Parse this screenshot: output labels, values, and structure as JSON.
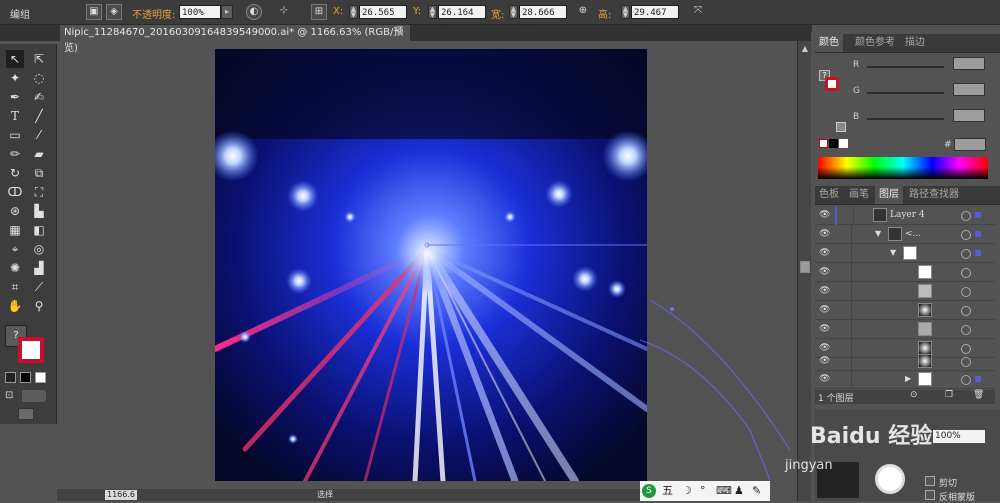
{
  "control_bar": {
    "group_label": "编组",
    "opacity_label": "不透明度:",
    "opacity_value": "100%",
    "x_label": "X:",
    "x_value": "26.565 mm",
    "y_label": "Y:",
    "y_value": "26.164 mm",
    "w_label": "宽:",
    "w_value": "28.666 mm",
    "h_label": "高:",
    "h_value": "29.467 mm"
  },
  "document": {
    "tab_title": "Nipic_11284670_20160309164839549000.ai* @ 1166.63% (RGB/预览)",
    "close_glyph": "×"
  },
  "color_panel": {
    "tabs": [
      "颜色",
      "颜色参考",
      "描边"
    ],
    "active_tab": 0,
    "channels": [
      "R",
      "G",
      "B"
    ],
    "hex_label": "#",
    "question_mark": "?"
  },
  "layers_panel": {
    "tabs": [
      "色板",
      "画笔",
      "图层",
      "路径查找器"
    ],
    "active_tab": 2,
    "layer_name": "Layer 4",
    "sublayer_name": "<...",
    "footer_count": "1 个图层"
  },
  "transparency": {
    "opacity_value": "100%",
    "clip_label": "剪切",
    "invert_mask_label": "反相蒙版"
  },
  "status_bar": {
    "zoom_value": "1166.6",
    "mode_label": "选择"
  },
  "taskbar": {
    "ime_label": "五",
    "items": [
      "☽",
      "°",
      "⌨",
      "♟",
      "✎"
    ]
  },
  "watermark": {
    "text": "Baidu 经验",
    "url_fragment": "jingyan"
  },
  "colors": {
    "panel_bg": "#535353",
    "bar_bg": "#3c3c3c",
    "accent_orange": "#e8a13a",
    "art_bg": "#070a2a"
  },
  "icons": {
    "eye": "eye-icon",
    "selection": "selection-tool-icon"
  }
}
